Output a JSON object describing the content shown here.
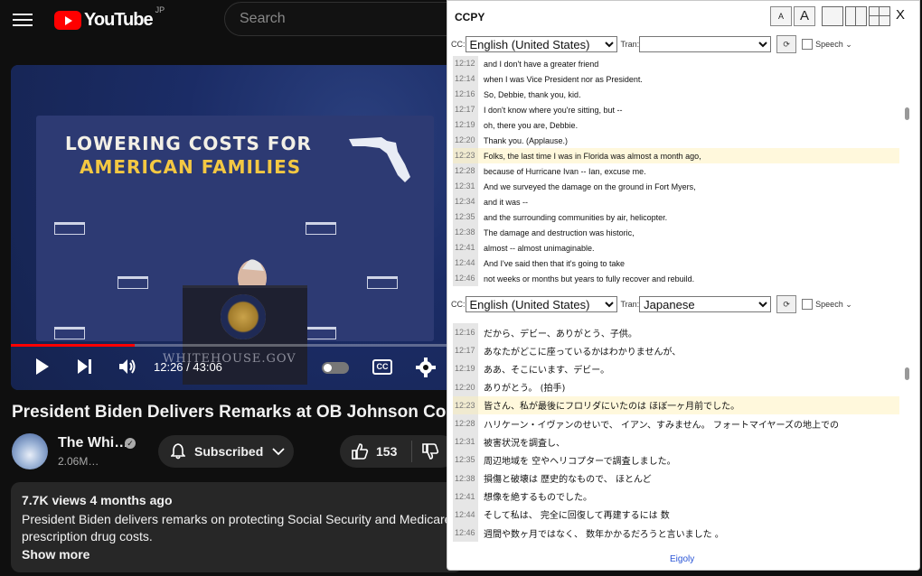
{
  "header": {
    "logo_text": "YouTube",
    "region": "JP",
    "search_placeholder": "Search"
  },
  "player": {
    "slide_line1": "LOWERING COSTS FOR",
    "slide_line2": "AMERICAN FAMILIES",
    "watermark": "WHITEHOUSE.GOV",
    "time": "12:26 / 43:06",
    "progress": 0.285,
    "cc_label": "CC"
  },
  "video": {
    "title": "President Biden Delivers Remarks at OB Johnson Commun",
    "channel_name": "The Whi…",
    "subscribers": "2.06M…",
    "subscribed_label": "Subscribed",
    "likes": "153"
  },
  "description": {
    "meta": "7.7K views  4 months ago",
    "text": "President Biden delivers remarks on protecting Social Security and Medicare prescription drug costs.",
    "show_more": "Show more"
  },
  "ccpy": {
    "title": "CCPY",
    "font_small": "A",
    "font_large": "A",
    "close": "X",
    "cc_label": "CC:",
    "tran_label": "Tran:",
    "speech_label": "Speech ⌄",
    "refresh_label": "⟳",
    "top_source": "English (United States)",
    "top_translation": "",
    "bottom_source": "English (United States)",
    "bottom_translation": "Japanese",
    "footer": "Eigoly",
    "english_lines": [
      {
        "t": "12:12",
        "text": "and I don't have a greater friend"
      },
      {
        "t": "12:14",
        "text": "when I was Vice President nor as President."
      },
      {
        "t": "12:16",
        "text": "So, Debbie, thank you, kid."
      },
      {
        "t": "12:17",
        "text": "I don't know where you're sitting, but --"
      },
      {
        "t": "12:19",
        "text": "oh, there you are, Debbie."
      },
      {
        "t": "12:20",
        "text": "Thank you. (Applause.)"
      },
      {
        "t": "12:23",
        "text": "Folks, the last time I was in Florida was almost a month ago,",
        "hl": true
      },
      {
        "t": "12:28",
        "text": "because of Hurricane Ivan -- Ian, excuse me."
      },
      {
        "t": "12:31",
        "text": "And we surveyed the damage on the ground in Fort Myers,"
      },
      {
        "t": "12:34",
        "text": "and it was --"
      },
      {
        "t": "12:35",
        "text": "and the surrounding communities by air, helicopter."
      },
      {
        "t": "12:38",
        "text": "The damage and destruction was historic,"
      },
      {
        "t": "12:41",
        "text": "almost -- almost unimaginable."
      },
      {
        "t": "12:44",
        "text": "And I've said then that it's going to take"
      },
      {
        "t": "12:46",
        "text": "not weeks or months but years to fully recover and rebuild."
      }
    ],
    "japanese_lines": [
      {
        "t": "12:16",
        "text": "だから、デビー、ありがとう、子供。"
      },
      {
        "t": "12:17",
        "text": "あなたがどこに座っているかはわかりませんが、"
      },
      {
        "t": "12:19",
        "text": "ああ、そこにいます、デビー。"
      },
      {
        "t": "12:20",
        "text": "ありがとう。 (拍手)"
      },
      {
        "t": "12:23",
        "text": "皆さん、私が最後にフロリダにいたのは ほぼ一ヶ月前でした。",
        "hl": true
      },
      {
        "t": "12:28",
        "text": "ハリケーン・イヴァンのせいで、 イアン、すみません。 フォートマイヤーズの地上での"
      },
      {
        "t": "12:31",
        "text": "被害状況を調査し、"
      },
      {
        "t": "12:35",
        "text": "周辺地域を 空やヘリコプターで調査しました。"
      },
      {
        "t": "12:38",
        "text": "損傷と破壊は 歴史的なもので、 ほとんど"
      },
      {
        "t": "12:41",
        "text": "想像を絶するものでした。"
      },
      {
        "t": "12:44",
        "text": "そして私は、 完全に回復して再建するには 数"
      },
      {
        "t": "12:46",
        "text": "週間や数ヶ月ではなく、 数年かかるだろうと言いました 。"
      }
    ]
  }
}
